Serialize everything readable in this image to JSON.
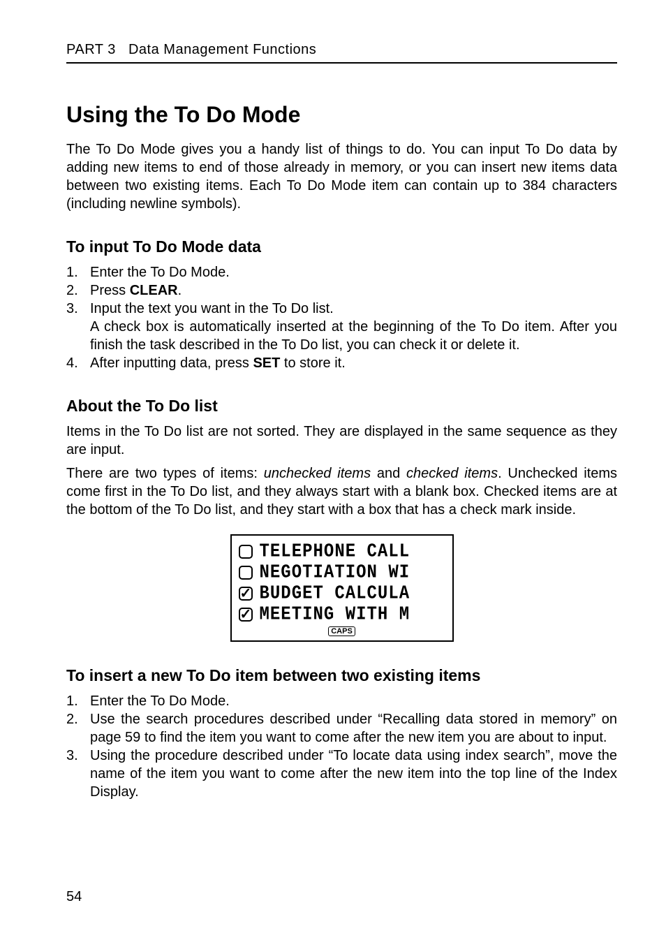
{
  "header": {
    "part": "PART 3",
    "section": "Data Management Functions"
  },
  "title": "Using the To Do Mode",
  "intro": "The To Do Mode gives you a handy list of things to do. You can input To Do data by adding new items to end of those already in memory, or you can insert new items data between two existing items. Each To Do Mode item can contain up to 384 characters (including newline symbols).",
  "sectionA": {
    "heading": "To input To Do Mode data",
    "steps": {
      "s1": "Enter the To Do Mode.",
      "s2a": "Press ",
      "s2b": "CLEAR",
      "s2c": ".",
      "s3a": "Input the text you want in the To Do list.",
      "s3b": "A check box is automatically inserted at the beginning of the To Do item. After you finish the task described in the To Do list, you can check it or delete it.",
      "s4a": "After inputting data, press ",
      "s4b": "SET",
      "s4c": " to store it."
    }
  },
  "sectionB": {
    "heading": "About the To Do list",
    "p1": "Items in the To Do list are not sorted. They are displayed in the same sequence as they are input.",
    "p2a": "There are two types of items: ",
    "p2b": "unchecked items",
    "p2c": " and ",
    "p2d": "checked items",
    "p2e": ". Unchecked items come first in the To Do list, and they always start with a blank box. Checked items are at the bottom of the To Do list, and they start with a box that has a check mark inside."
  },
  "lcd": {
    "rows": [
      {
        "checked": false,
        "text": "TELEPHONE CALL"
      },
      {
        "checked": false,
        "text": "NEGOTIATION WI"
      },
      {
        "checked": true,
        "text": "BUDGET CALCULA"
      },
      {
        "checked": true,
        "text": "MEETING WITH M"
      }
    ],
    "caps": "CAPS"
  },
  "sectionC": {
    "heading": "To insert a new To Do item between two existing items",
    "steps": {
      "s1": "Enter the To Do Mode.",
      "s2": "Use the search procedures described under “Recalling data stored in memory” on page 59 to find the item you want to come after the new item you are about to input.",
      "s3": "Using the procedure described under “To locate data using index search”, move the name of the item you want to come after the new item into the top line of the Index Display."
    }
  },
  "pageNumber": "54"
}
